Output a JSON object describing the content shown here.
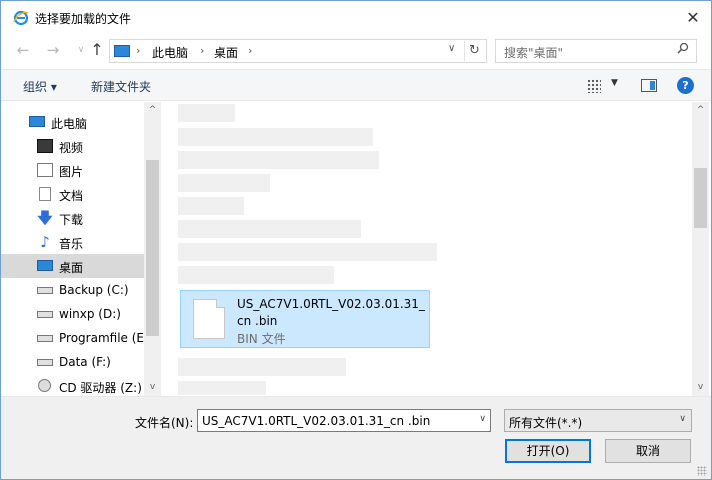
{
  "window": {
    "title": "选择要加载的文件",
    "app_icon": "ie-logo-icon",
    "close_glyph": "✕"
  },
  "navigation": {
    "back_glyph": "←",
    "forward_glyph": "→",
    "up_glyph": "↑",
    "breadcrumb": [
      "此电脑",
      "桌面"
    ],
    "separator": "›",
    "dropdown_glyph": "∨",
    "refresh_glyph": "↻"
  },
  "search": {
    "placeholder": "搜索\"桌面\"",
    "icon_glyph": "⌕"
  },
  "toolbar": {
    "organize_label": "组织 ▾",
    "new_folder_label": "新建文件夹",
    "view_dropdown_glyph": "▼",
    "help_glyph": "?"
  },
  "sidebar": {
    "items": [
      {
        "label": "此电脑",
        "icon": "computer-icon"
      },
      {
        "label": "视频",
        "icon": "video-icon"
      },
      {
        "label": "图片",
        "icon": "pictures-icon"
      },
      {
        "label": "文档",
        "icon": "documents-icon"
      },
      {
        "label": "下载",
        "icon": "download-icon",
        "glyph": "🡇"
      },
      {
        "label": "音乐",
        "icon": "music-icon",
        "glyph": "♪"
      },
      {
        "label": "桌面",
        "icon": "desktop-icon",
        "selected": true
      },
      {
        "label": "Backup (C:)",
        "icon": "drive-icon"
      },
      {
        "label": "winxp (D:)",
        "icon": "drive-icon"
      },
      {
        "label": "Programfile (E:",
        "icon": "drive-icon"
      },
      {
        "label": "Data (F:)",
        "icon": "drive-icon"
      },
      {
        "label": "CD 驱动器 (Z:)",
        "icon": "cd-drive-icon"
      }
    ],
    "scroll_up_glyph": "^",
    "scroll_down_glyph": "v"
  },
  "content": {
    "selected_file": {
      "name": "US_AC7V1.0RTL_V02.03.01.31_cn .bin",
      "type": "BIN 文件",
      "icon": "file-icon"
    },
    "scroll_up_glyph": "^",
    "scroll_down_glyph": "v"
  },
  "footer": {
    "filename_label": "文件名(N):",
    "filename_value": "US_AC7V1.0RTL_V02.03.01.31_cn .bin",
    "filter_value": "所有文件(*.*)",
    "dropdown_glyph": "∨",
    "open_label": "打开(O)",
    "cancel_label": "取消"
  }
}
